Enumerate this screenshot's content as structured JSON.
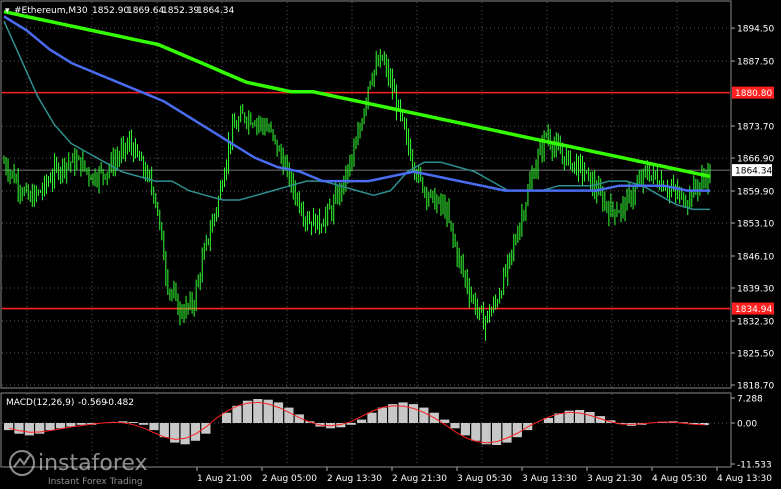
{
  "header": {
    "symbol_label": "#Ethereum,M30",
    "ohlc": [
      "1852.90",
      "1869.64",
      "1852.39",
      "1864.34"
    ]
  },
  "macd_header": {
    "label": "MACD(12,26,9)",
    "values": [
      "-0.569",
      "-0.482"
    ]
  },
  "watermark": {
    "brand": "instaforex",
    "tagline": "Instant Forex Trading"
  },
  "colors": {
    "background": "#000000",
    "grid": "#5a5a5a",
    "candle": "#33ff33",
    "ma_fast": "#2f8f8f",
    "ma_mid": "#4a6cf0",
    "ma_slow": "#33ff00",
    "hline": "#ff2020",
    "macd_hist": "#c8c8c8",
    "macd_signal": "#ff2020"
  },
  "chart_data": [
    {
      "type": "candlestick",
      "y_ticks": [
        "1894.50",
        "1887.50",
        "1880.80",
        "1873.70",
        "1866.90",
        "1864.34",
        "1859.90",
        "1853.10",
        "1846.10",
        "1839.30",
        "1834.94",
        "1832.30",
        "1825.50",
        "1818.70"
      ],
      "ylim": [
        1818.7,
        1897.5
      ],
      "x_tick_labels": [
        "1 Aug 21:00",
        "2 Aug 05:00",
        "2 Aug 13:30",
        "2 Aug 21:30",
        "3 Aug 05:30",
        "3 Aug 13:30",
        "3 Aug 21:30",
        "4 Aug 05:30",
        "4 Aug 13:30"
      ],
      "horizontal_levels": [
        {
          "label": "1880.80",
          "value": 1880.8
        },
        {
          "label": "1834.94",
          "value": 1834.94
        }
      ],
      "current_price": {
        "label": "1864.34",
        "value": 1864.34
      },
      "close_path": [
        1866,
        1862,
        1858,
        1860,
        1864,
        1866,
        1866,
        1863,
        1864,
        1867,
        1870,
        1865,
        1859,
        1840,
        1834,
        1836,
        1848,
        1858,
        1872,
        1876,
        1875,
        1873,
        1867,
        1860,
        1854,
        1853,
        1856,
        1862,
        1870,
        1884,
        1888,
        1880,
        1870,
        1862,
        1858,
        1856,
        1846,
        1838,
        1832,
        1836,
        1844,
        1854,
        1864,
        1872,
        1868,
        1866,
        1864,
        1860,
        1856,
        1856,
        1860,
        1864,
        1862,
        1860,
        1858,
        1861,
        1864
      ],
      "ma_fast": [
        1896,
        1888,
        1880,
        1874,
        1870,
        1868,
        1866,
        1864,
        1863,
        1862,
        1862,
        1860,
        1859,
        1858,
        1858,
        1859,
        1860,
        1861,
        1862,
        1862,
        1861,
        1860,
        1859,
        1860,
        1864,
        1866,
        1866,
        1865,
        1864,
        1862,
        1860,
        1860,
        1860,
        1861,
        1861,
        1861,
        1862,
        1862,
        1861,
        1859,
        1857,
        1856,
        1856
      ],
      "ma_mid": [
        1897,
        1894,
        1890,
        1887,
        1885,
        1883,
        1881,
        1879,
        1876,
        1873,
        1870,
        1867,
        1865,
        1864,
        1862,
        1862,
        1862,
        1863,
        1864,
        1863,
        1862,
        1861,
        1860,
        1860,
        1860,
        1860,
        1860,
        1861,
        1861,
        1861,
        1860,
        1860
      ],
      "ma_slow": [
        1898,
        1897,
        1896,
        1895,
        1894,
        1893,
        1892,
        1891,
        1889,
        1887,
        1885,
        1883,
        1882,
        1881,
        1881,
        1880,
        1879,
        1878,
        1877,
        1876,
        1875,
        1874,
        1873,
        1872,
        1871,
        1870,
        1869,
        1868,
        1867,
        1866,
        1865,
        1864,
        1863
      ]
    },
    {
      "type": "bar",
      "title": "MACD(12,26,9)",
      "y_ticks": [
        "7.288",
        "0.00",
        "-11.533"
      ],
      "ylim": [
        -11.533,
        7.288
      ],
      "histogram": [
        -2,
        -3,
        -3.5,
        -3,
        -2,
        -1.5,
        -1,
        -0.5,
        -0.5,
        0,
        0.3,
        0.5,
        0.3,
        -0.5,
        -2,
        -4,
        -5.5,
        -6,
        -5,
        -3,
        0,
        3,
        5,
        6.5,
        7,
        6.8,
        6,
        4.5,
        2.5,
        0.5,
        -1,
        -1.5,
        -1.2,
        -0.5,
        1,
        3,
        4.5,
        5.5,
        6,
        5.5,
        4.5,
        3,
        1,
        -1.5,
        -3.5,
        -5,
        -6,
        -6.2,
        -5.5,
        -4,
        -2,
        0,
        1.5,
        2.8,
        3.6,
        3.8,
        3.2,
        2,
        0.8,
        -0.3,
        -0.8,
        -0.5,
        0,
        0.4,
        0.5,
        0.2,
        -0.3,
        -0.6
      ],
      "signal": [
        -1.5,
        -2.2,
        -2.6,
        -2.5,
        -2.1,
        -1.6,
        -1.1,
        -0.7,
        -0.3,
        0,
        0.2,
        0.1,
        -0.5,
        -1.5,
        -2.8,
        -4,
        -4.6,
        -4.3,
        -3,
        -1,
        1.5,
        3.5,
        5,
        5.8,
        6,
        5.5,
        4.5,
        3,
        1.5,
        0.2,
        -0.6,
        -0.8,
        -0.4,
        0.5,
        2,
        3.5,
        4.6,
        5,
        4.9,
        4.2,
        3,
        1.4,
        -0.5,
        -2.5,
        -4.2,
        -5.2,
        -5.6,
        -5.2,
        -4.2,
        -2.8,
        -1,
        0.5,
        1.8,
        2.7,
        3.1,
        2.9,
        2.2,
        1.2,
        0.3,
        -0.3,
        -0.4,
        -0.2,
        0.1,
        0.3,
        0.2,
        -0.1,
        -0.4,
        -0.5
      ]
    }
  ]
}
